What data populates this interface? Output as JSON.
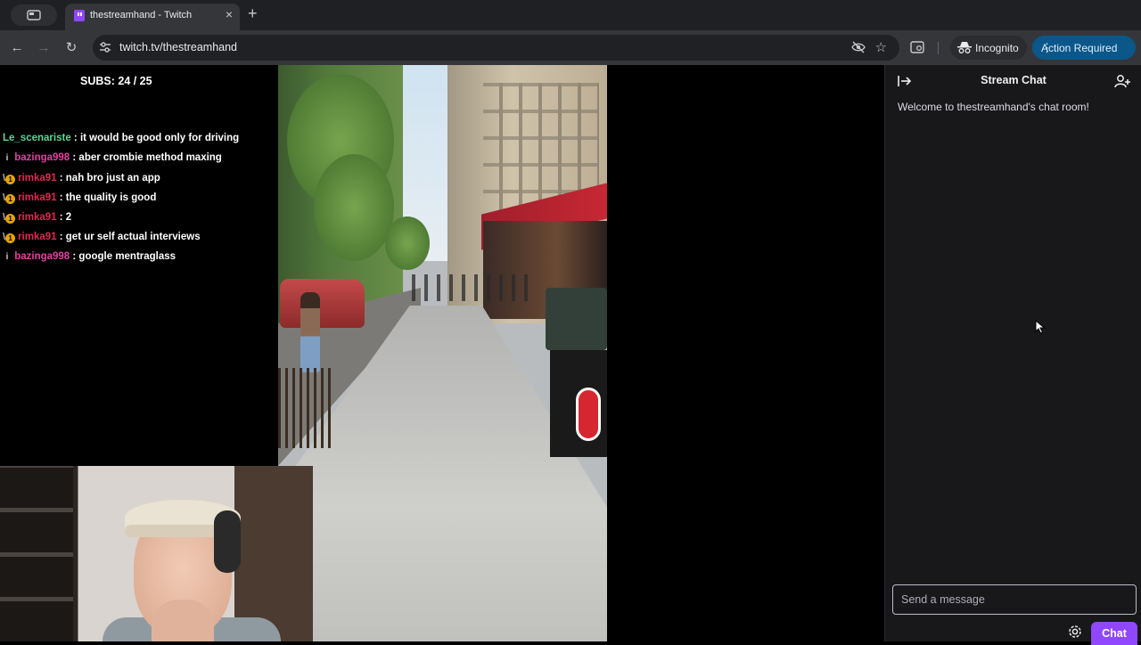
{
  "browser": {
    "tab_title": "thestreamhand - Twitch",
    "tab_close": "×",
    "new_tab": "+",
    "url": "twitch.tv/thestreamhand",
    "incognito_label": "Incognito",
    "action_required_label": "Action Required",
    "nav": {
      "back": "←",
      "forward": "→",
      "reload": "↻"
    },
    "star_glyph": "☆",
    "menu_glyph": "⋮"
  },
  "stream": {
    "subs_label": "SUBS: 24 / 25",
    "chat": [
      {
        "user": "Le_scenariste",
        "color": "green",
        "badges": [],
        "text": ": it would be good only for driving"
      },
      {
        "user": "bazinga998",
        "color": "pink",
        "badges": [
          "i"
        ],
        "text": ": aber crombie method maxing"
      },
      {
        "user": "rimka91",
        "color": "red",
        "badges": [
          "slash",
          "dot"
        ],
        "text": ": nah bro just an app"
      },
      {
        "user": "rimka91",
        "color": "red",
        "badges": [
          "slash",
          "dot"
        ],
        "text": ": the quality is good"
      },
      {
        "user": "rimka91",
        "color": "red",
        "badges": [
          "slash",
          "dot"
        ],
        "text": ": 2"
      },
      {
        "user": "rimka91",
        "color": "red",
        "badges": [
          "slash",
          "dot"
        ],
        "text": ": get ur self actual interviews"
      },
      {
        "user": "bazinga998",
        "color": "pink",
        "badges": [
          "i"
        ],
        "text": ": google mentraglass"
      }
    ],
    "badge_glyphs": {
      "i": "i",
      "slash": "\\",
      "dot": "1"
    }
  },
  "sidebar": {
    "title": "Stream Chat",
    "welcome": "Welcome to thestreamhand's chat room!",
    "input_placeholder": "Send a message",
    "chat_button": "Chat"
  },
  "colors": {
    "twitch_purple": "#9147ff",
    "action_required_bg": "#0b5789",
    "user_green": "#5cd697",
    "user_pink": "#e33fa1",
    "user_red": "#e0284e"
  }
}
